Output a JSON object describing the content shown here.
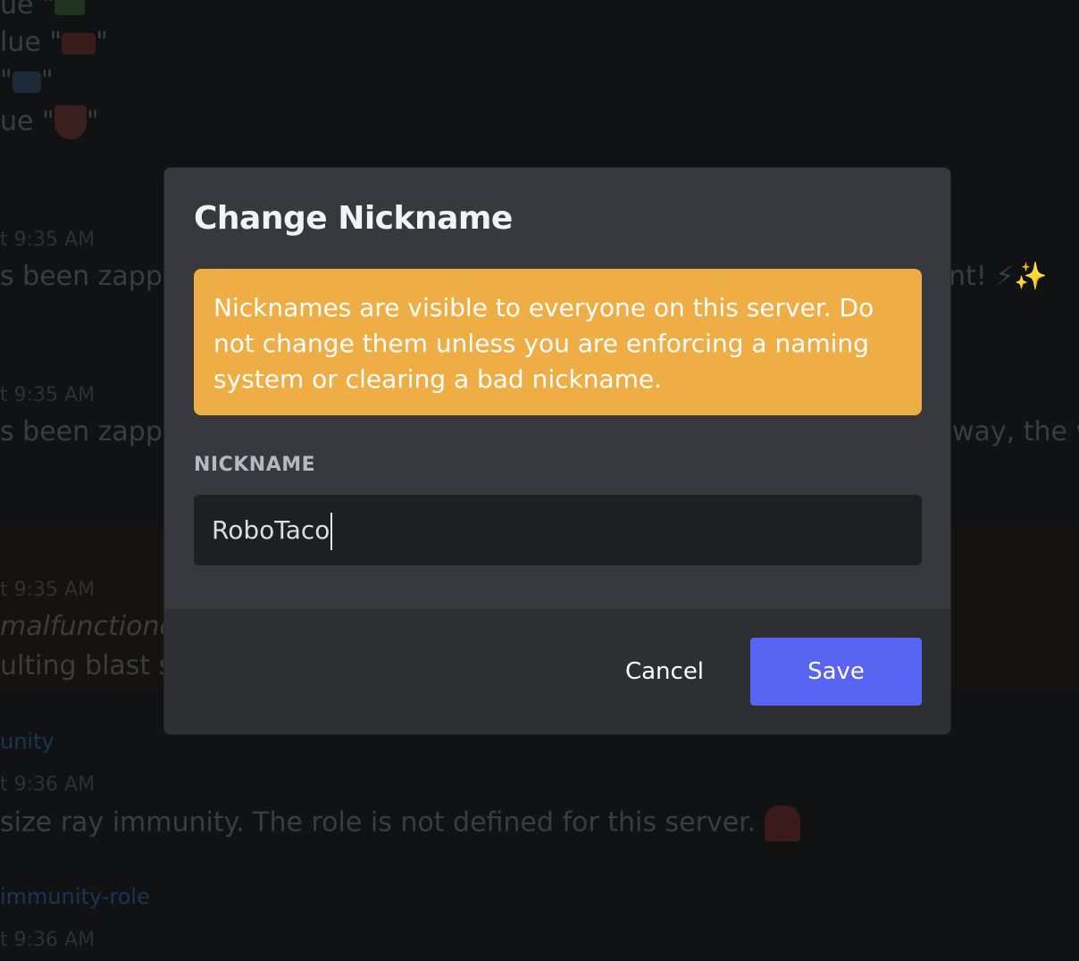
{
  "background": {
    "lines": [
      {
        "text": "ue \"",
        "emoji": "water-gun-icon",
        "suffix": ""
      },
      {
        "text": "lue \"",
        "emoji": "red-ray-gun-icon",
        "suffix": "\""
      },
      {
        "text": "\"",
        "emoji": "blue-ray-gun-icon",
        "suffix": "\""
      },
      {
        "text": "ue \"",
        "emoji": "shield-icon",
        "suffix": "\""
      }
    ],
    "messages": [
      {
        "time": "t 9:35 AM",
        "text_left": "s been zappec",
        "text_right": "nt! ⚡✨"
      },
      {
        "time": "t 9:35 AM",
        "text_left": "s been zappec",
        "text_right": "way, the wa"
      },
      {
        "time": "t 9:35 AM",
        "text_left": "malfunctionec",
        "text_left2": "ulting blast sh"
      },
      {
        "link": "unity",
        "time": "t 9:36 AM",
        "text": " size ray immunity. The role is not defined for this server."
      },
      {
        "link": "immunity-role",
        "time": "t 9:36 AM"
      }
    ]
  },
  "modal": {
    "title": "Change Nickname",
    "warning": "Nicknames are visible to everyone on this server. Do not change them unless you are enforcing a naming system or clearing a bad nickname.",
    "field_label": "NICKNAME",
    "nickname_value": "RoboTaco",
    "cancel_label": "Cancel",
    "save_label": "Save"
  },
  "colors": {
    "accent": "#5865f2",
    "warning": "#efae45",
    "modal_bg": "#37393e",
    "input_bg": "#1e1f22"
  }
}
